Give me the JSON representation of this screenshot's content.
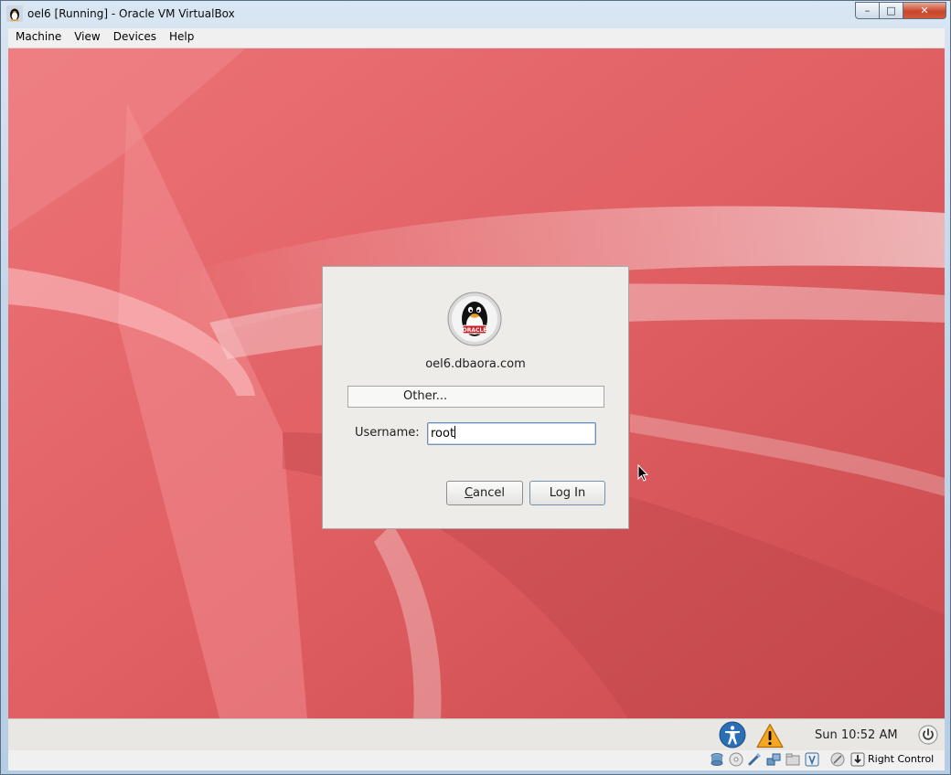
{
  "window": {
    "title": "oel6 [Running] - Oracle VM VirtualBox",
    "controls": {
      "minimize": "–",
      "maximize": "□",
      "close": "✕"
    }
  },
  "menubar": {
    "items": [
      {
        "label": "Machine"
      },
      {
        "label": "View"
      },
      {
        "label": "Devices"
      },
      {
        "label": "Help"
      }
    ]
  },
  "login_dialog": {
    "logo_icon": "oracle-linux-penguin-icon",
    "logo_text": "ORACLE",
    "hostname": "oel6.dbaora.com",
    "other_button": "Other...",
    "username_label": "Username:",
    "username_value": "root",
    "cancel_button": {
      "mnemonic": "C",
      "rest": "ancel"
    },
    "login_button": "Log In"
  },
  "gnome_panel": {
    "clock": "Sun 10:52 AM",
    "icons": [
      "accessibility-icon",
      "warning-icon",
      "power-icon"
    ]
  },
  "statusbar": {
    "icons": [
      "hard-disk-icon",
      "optical-drive-icon",
      "usb-icon",
      "network-icon",
      "shared-folders-icon",
      "video-capture-icon",
      "mouse-integration-icon",
      "host-key-icon"
    ],
    "host_key": "Right Control"
  },
  "colors": {
    "vm_background": "#e1666a",
    "dialog_bg": "#edece9",
    "warning": "#f5a623",
    "accessibility": "#2a6fb5"
  }
}
